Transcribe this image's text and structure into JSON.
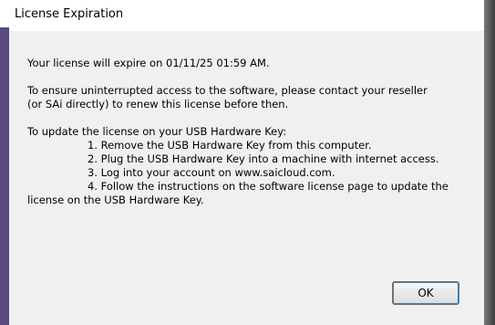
{
  "dialog": {
    "title": "License Expiration",
    "expiry_message": "Your license will expire on 01/11/25 01:59 AM.",
    "renew_line1": "To ensure uninterrupted access to the software, please contact your reseller",
    "renew_line2": "(or SAi directly) to renew this license before then.",
    "update_heading": "To update the license on your USB Hardware Key:",
    "steps": [
      "1. Remove the USB Hardware Key from this computer.",
      "2. Plug the USB Hardware Key into a machine with internet access.",
      "3. Log into your account on www.saicloud.com.",
      "4. Follow the instructions on the software license page to update the"
    ],
    "step4_continuation": "license on the USB Hardware Key.",
    "ok_label": "OK"
  },
  "colors": {
    "left_accent": "#5b4a7d",
    "dialog_background": "#f0f0f0",
    "button_focus": "#3c7fb1"
  }
}
